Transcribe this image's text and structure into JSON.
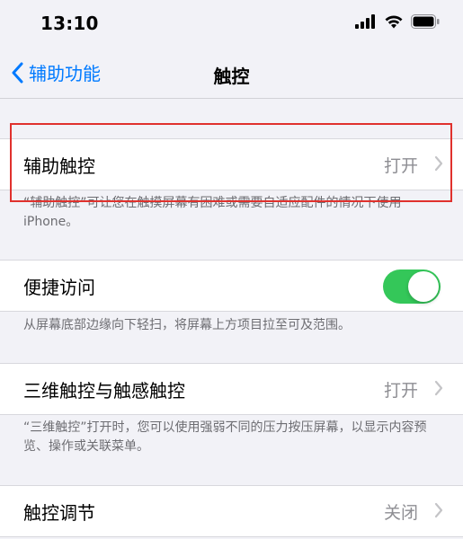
{
  "status_bar": {
    "time": "13:10",
    "icons": [
      "cellular-signal-icon",
      "wifi-icon",
      "battery-icon"
    ]
  },
  "nav": {
    "back_label": "辅助功能",
    "title": "触控"
  },
  "sections": {
    "assistive_touch": {
      "label": "辅助触控",
      "value": "打开",
      "footnote": "“辅助触控”可让您在触摸屏幕有困难或需要自适应配件的情况下使用 iPhone。"
    },
    "reachability": {
      "label": "便捷访问",
      "toggle_on": true,
      "footnote": "从屏幕底部边缘向下轻扫，将屏幕上方项目拉至可及范围。"
    },
    "touch_3d": {
      "label": "三维触控与触感触控",
      "value": "打开",
      "footnote": "“三维触控”打开时，您可以使用强弱不同的压力按压屏幕，以显示内容预览、操作或关联菜单。"
    },
    "touch_accommodations": {
      "label": "触控调节",
      "value": "关闭"
    }
  },
  "colors": {
    "accent": "#007aff",
    "toggle_on": "#34c759",
    "highlight": "#e0312d",
    "background": "#f2f2f7"
  }
}
